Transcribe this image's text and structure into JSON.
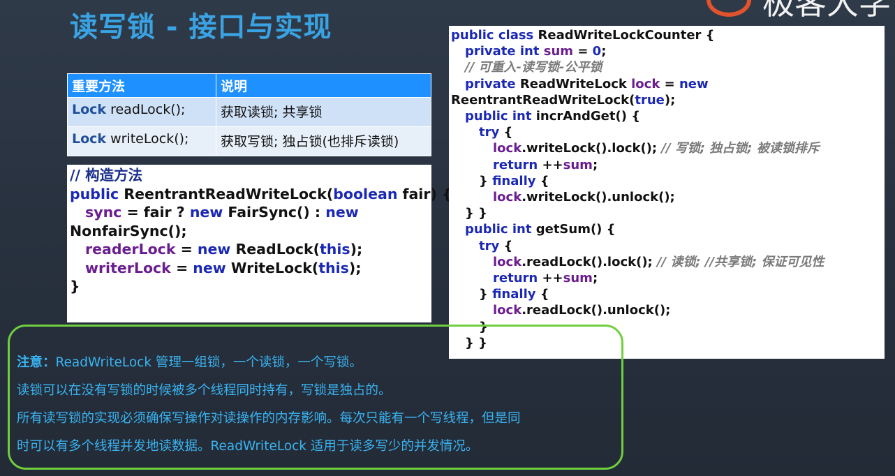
{
  "slide": {
    "title": "读写锁 - 接口与实现",
    "logo_text": "极客大学"
  },
  "methods_table": {
    "headers": [
      "重要方法",
      "说明"
    ],
    "rows": [
      {
        "type": "Lock",
        "method": " readLock();",
        "desc": "获取读锁; 共享锁"
      },
      {
        "type": "Lock",
        "method": " writeLock();",
        "desc": "获取写锁; 独占锁(也排斥读锁)"
      }
    ]
  },
  "constructor_code": {
    "comment": "// 构造方法",
    "l1_a": "public ",
    "l1_b": "ReentrantReadWriteLock(",
    "l1_c": "boolean",
    "l1_d": " fair) {",
    "l2_field": "sync",
    "l2_a": " = fair ? ",
    "l2_new1": "new",
    "l2_b": " FairSync() : ",
    "l2_new2": "new",
    "l3": "NonfairSync();",
    "l4_field": "readerLock",
    "l4_a": " = ",
    "l4_new": "new",
    "l4_b": " ReadLock(",
    "l4_this": "this",
    "l4_c": ");",
    "l5_field": "writerLock",
    "l5_a": " = ",
    "l5_new": "new",
    "l5_b": " WriteLock(",
    "l5_this": "this",
    "l5_c": ");",
    "l6": "}"
  },
  "counter_code": {
    "l1_kw": "public class",
    "l1_rest": " ReadWriteLockCounter {",
    "l2_kw": "private int",
    "l2_field": " sum",
    "l2_a": " = ",
    "l2_num": "0",
    "l2_b": ";",
    "l3_comment": "// 可重入-读写锁-公平锁",
    "l4_kw": "private",
    "l4_a": " ReadWriteLock ",
    "l4_field": "lock",
    "l4_b": " = ",
    "l4_new": "new",
    "l5_a": "ReentrantReadWriteLock(",
    "l5_true": "true",
    "l5_b": ");",
    "l6_kw": "public int",
    "l6_rest": " incrAndGet() {",
    "l7_kw": "try",
    "l7_rest": " {",
    "l8_field": "lock",
    "l8_rest": ".writeLock().lock();  ",
    "l8_comment": "// 写锁; 独占锁; 被读锁排斥",
    "l9_kw": "return",
    "l9_a": " ++",
    "l9_field": "sum",
    "l9_b": ";",
    "l10_a": "} ",
    "l10_kw": "finally",
    "l10_b": " {",
    "l11_field": "lock",
    "l11_rest": ".writeLock().unlock();",
    "l12": "} }",
    "l13_kw": "public int",
    "l13_rest": " getSum() {",
    "l14_kw": "try",
    "l14_rest": " {",
    "l15_field": "lock",
    "l15_rest": ".readLock().lock(); ",
    "l15_comment": "// 读锁; //共享锁; 保证可见性",
    "l16_kw": "return",
    "l16_a": " ++",
    "l16_field": "sum",
    "l16_b": ";",
    "l17_a": "} ",
    "l17_kw": "finally",
    "l17_b": " {",
    "l18_field": "lock",
    "l18_rest": ".readLock().unlock();",
    "l19": "}",
    "l20": "} }"
  },
  "note": {
    "label": "注意：",
    "line1": "ReadWriteLock 管理一组锁，一个读锁，一个写锁。",
    "line2": "读锁可以在没有写锁的时候被多个线程同时持有，写锁是独占的。",
    "line3": "所有读写锁的实现必须确保写操作对读操作的内存影响。每次只能有一个写线程，但是同",
    "line4": "时可以有多个线程并发地读数据。ReadWriteLock 适用于读多写少的并发情况。"
  },
  "colors": {
    "title": "#3aa3e3",
    "table_header": "#1e90ff",
    "note_border": "#6fcf3f",
    "note_text": "#3ab4f2",
    "logo_accent": "#e2532d"
  }
}
